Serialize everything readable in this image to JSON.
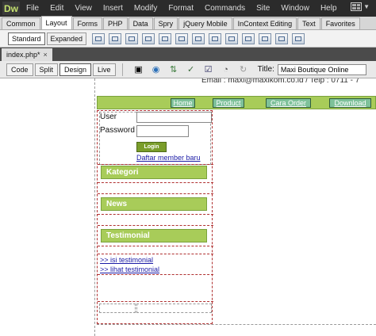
{
  "app": {
    "logo": "Dw"
  },
  "menu": [
    "File",
    "Edit",
    "View",
    "Insert",
    "Modify",
    "Format",
    "Commands",
    "Site",
    "Window",
    "Help"
  ],
  "insert_tabs": [
    "Common",
    "Layout",
    "Forms",
    "PHP",
    "Data",
    "Spry",
    "jQuery Mobile",
    "InContext Editing",
    "Text",
    "Favorites"
  ],
  "insert_active": "Layout",
  "layout_toolbar": {
    "standard": "Standard",
    "expanded": "Expanded"
  },
  "document_tab": {
    "name": "index.php*"
  },
  "doc_toolbar": {
    "code": "Code",
    "split": "Split",
    "design": "Design",
    "live": "Live",
    "title_label": "Title:",
    "title_value": "Maxi Boutique Online"
  },
  "page": {
    "contact": "Email : maxi@maxikom.co.id / Telp : 0711 - 7",
    "nav": [
      "Home",
      "Product",
      "Cara Order",
      "Download"
    ],
    "login": {
      "user_label": "User",
      "password_label": "Password",
      "button": "Login",
      "register_link": "Daftar member baru"
    },
    "sections": [
      "Kategori",
      "News",
      "Testimonial"
    ],
    "testimonial_links": [
      ">> isi testimonial",
      ">> lihat testimonial"
    ]
  },
  "colors": {
    "green_bar": "#a8cc59",
    "nav_button": "#7ec19a",
    "login_button": "#7a9d2a"
  }
}
